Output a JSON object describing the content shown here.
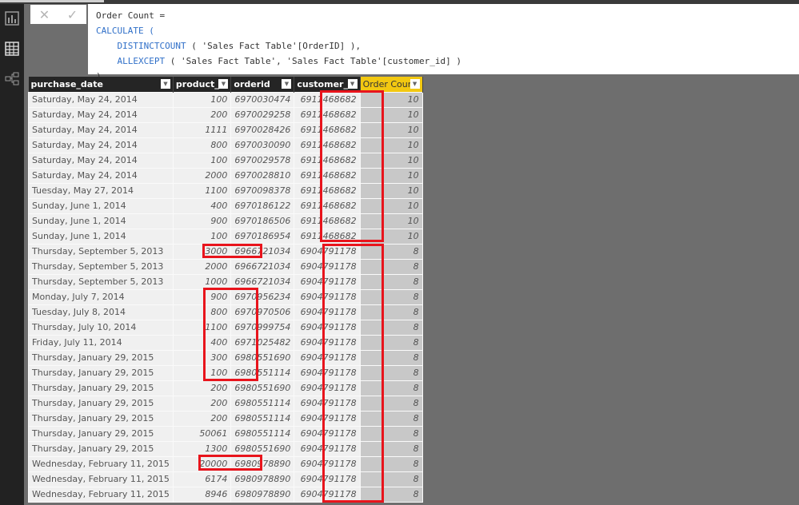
{
  "formula": {
    "line1": "Order Count =",
    "line2": "CALCULATE (",
    "line3_fn": "DISTINCTCOUNT",
    "line3_rest": " ( 'Sales Fact Table'[OrderID] ),",
    "line4_fn": "ALLEXCEPT",
    "line4_rest": " ( 'Sales Fact Table', 'Sales Fact Table'[customer_id] )",
    "line5": ")",
    "cancel": "✕",
    "commit": "✓"
  },
  "sidebar": [
    {
      "icon": "report-icon"
    },
    {
      "icon": "data-icon"
    },
    {
      "icon": "relationships-icon"
    }
  ],
  "columns": [
    "purchase_date",
    "product_id",
    "orderid",
    "customer_id",
    "Order Count"
  ],
  "accent": "#f2c811",
  "highlight": "#e8141c",
  "rows": [
    [
      "Saturday, May 24, 2014",
      "100",
      "6970030474",
      "6911468682",
      "10"
    ],
    [
      "Saturday, May 24, 2014",
      "200",
      "6970029258",
      "6911468682",
      "10"
    ],
    [
      "Saturday, May 24, 2014",
      "1111",
      "6970028426",
      "6911468682",
      "10"
    ],
    [
      "Saturday, May 24, 2014",
      "800",
      "6970030090",
      "6911468682",
      "10"
    ],
    [
      "Saturday, May 24, 2014",
      "100",
      "6970029578",
      "6911468682",
      "10"
    ],
    [
      "Saturday, May 24, 2014",
      "2000",
      "6970028810",
      "6911468682",
      "10"
    ],
    [
      "Tuesday, May 27, 2014",
      "1100",
      "6970098378",
      "6911468682",
      "10"
    ],
    [
      "Sunday, June 1, 2014",
      "400",
      "6970186122",
      "6911468682",
      "10"
    ],
    [
      "Sunday, June 1, 2014",
      "900",
      "6970186506",
      "6911468682",
      "10"
    ],
    [
      "Sunday, June 1, 2014",
      "100",
      "6970186954",
      "6911468682",
      "10"
    ],
    [
      "Thursday, September 5, 2013",
      "3000",
      "6966721034",
      "6904791178",
      "8"
    ],
    [
      "Thursday, September 5, 2013",
      "2000",
      "6966721034",
      "6904791178",
      "8"
    ],
    [
      "Thursday, September 5, 2013",
      "1000",
      "6966721034",
      "6904791178",
      "8"
    ],
    [
      "Monday, July 7, 2014",
      "900",
      "6970956234",
      "6904791178",
      "8"
    ],
    [
      "Tuesday, July 8, 2014",
      "800",
      "6970970506",
      "6904791178",
      "8"
    ],
    [
      "Thursday, July 10, 2014",
      "1100",
      "6970999754",
      "6904791178",
      "8"
    ],
    [
      "Friday, July 11, 2014",
      "400",
      "6971025482",
      "6904791178",
      "8"
    ],
    [
      "Thursday, January 29, 2015",
      "300",
      "6980551690",
      "6904791178",
      "8"
    ],
    [
      "Thursday, January 29, 2015",
      "100",
      "6980551114",
      "6904791178",
      "8"
    ],
    [
      "Thursday, January 29, 2015",
      "200",
      "6980551690",
      "6904791178",
      "8"
    ],
    [
      "Thursday, January 29, 2015",
      "200",
      "6980551114",
      "6904791178",
      "8"
    ],
    [
      "Thursday, January 29, 2015",
      "200",
      "6980551114",
      "6904791178",
      "8"
    ],
    [
      "Thursday, January 29, 2015",
      "50061",
      "6980551114",
      "6904791178",
      "8"
    ],
    [
      "Thursday, January 29, 2015",
      "1300",
      "6980551690",
      "6904791178",
      "8"
    ],
    [
      "Wednesday, February 11, 2015",
      "20000",
      "6980978890",
      "6904791178",
      "8"
    ],
    [
      "Wednesday, February 11, 2015",
      "6174",
      "6980978890",
      "6904791178",
      "8"
    ],
    [
      "Wednesday, February 11, 2015",
      "8946",
      "6980978890",
      "6904791178",
      "8"
    ]
  ]
}
